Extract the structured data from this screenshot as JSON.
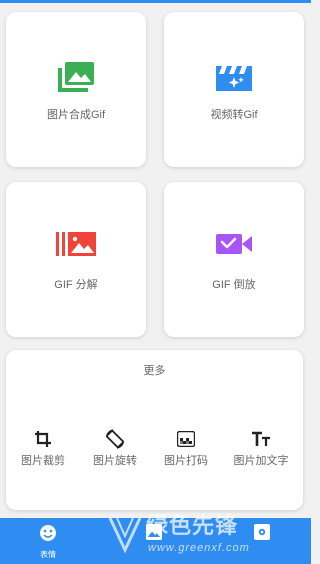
{
  "cards": [
    {
      "label": "图片合成Gif",
      "icon": "gallery-icon",
      "color": "#3cae54"
    },
    {
      "label": "视频转Gif",
      "icon": "clapperboard-sparkle-icon",
      "color": "#2f8cf0"
    },
    {
      "label": "GIF 分解",
      "icon": "film-split-icon",
      "color": "#f04438"
    },
    {
      "label": "GIF 倒放",
      "icon": "reverse-video-icon",
      "color": "#a855f7"
    }
  ],
  "more": {
    "title": "更多",
    "tools": [
      {
        "label": "图片裁剪",
        "icon": "crop-icon"
      },
      {
        "label": "图片旋转",
        "icon": "rotate-icon"
      },
      {
        "label": "图片打码",
        "icon": "mosaic-icon"
      },
      {
        "label": "图片加文字",
        "icon": "text-icon"
      }
    ]
  },
  "bottom_nav": {
    "tabs": [
      {
        "label": "表情",
        "icon": "smile-icon",
        "active": true
      },
      {
        "label": "",
        "icon": "image-icon",
        "active": false
      },
      {
        "label": "",
        "icon": "settings-icon",
        "active": false
      }
    ]
  },
  "watermark": {
    "text": "绿色先锋",
    "url": "www.greenxf.com"
  },
  "colors": {
    "accent": "#2f8cf0",
    "background": "#f1f1f1",
    "card": "#ffffff",
    "text": "#666666"
  }
}
